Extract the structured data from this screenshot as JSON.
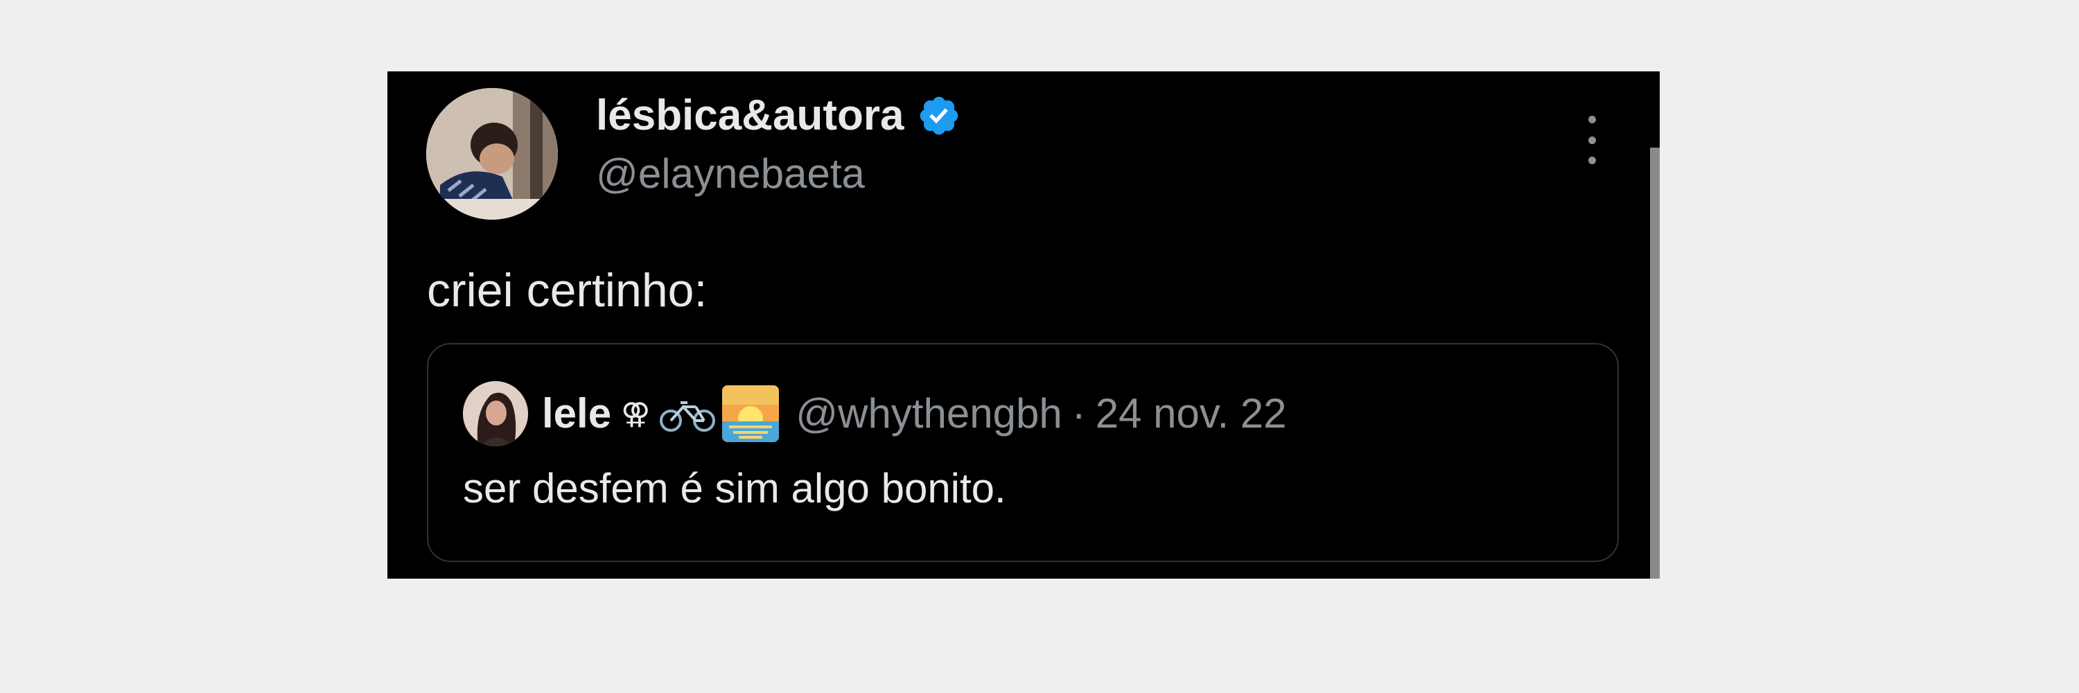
{
  "tweet": {
    "author": {
      "display_name": "lésbica&autora",
      "handle": "@elaynebaeta",
      "verified": true,
      "avatar_icon": "avatar-photo"
    },
    "text": "criei certinho:",
    "menu_icon": "more-vertical-icon",
    "quote": {
      "author": {
        "display_name": "lele",
        "sign": "⚢",
        "emoji": [
          "bicycle-emoji",
          "sunrise-emoji"
        ],
        "handle": "@whythengbh",
        "separator": "·",
        "date": "24 nov. 22"
      },
      "text": "ser desfem é sim algo bonito."
    }
  },
  "colors": {
    "background": "#efefef",
    "card": "#000000",
    "primary_text": "#e7e9ea",
    "secondary_text": "#8b9095",
    "verified_badge": "#1d9bf0",
    "quote_border": "#2f3336"
  }
}
